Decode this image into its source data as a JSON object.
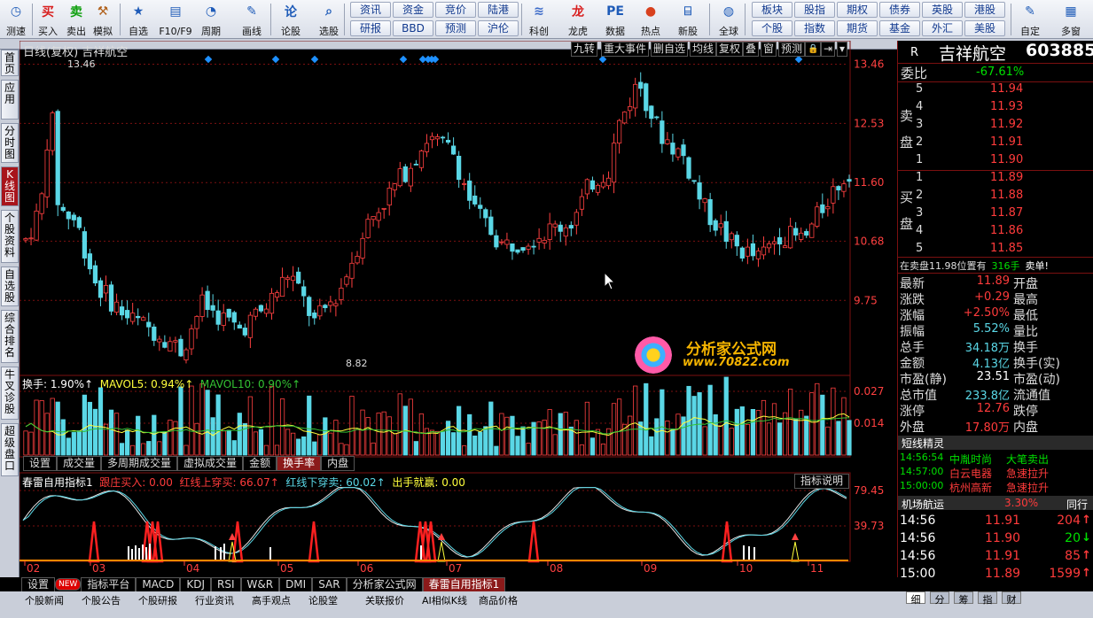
{
  "toolbar": {
    "items": [
      {
        "label": "测速",
        "icon": "clock-icon",
        "sym": "◷",
        "color": "#1e5bb8"
      },
      {
        "label": "买入",
        "icon": "buy-icon",
        "sym": "买",
        "color": "#d81e1e"
      },
      {
        "label": "卖出",
        "icon": "sell-icon",
        "sym": "卖",
        "color": "#10a010"
      },
      {
        "label": "模拟",
        "icon": "hammer-icon",
        "sym": "⚒",
        "color": "#b0601a"
      },
      {
        "label": "自选",
        "icon": "star-icon",
        "sym": "★",
        "color": "#1e5bb8"
      },
      {
        "label": "F10/F9",
        "icon": "f10-icon",
        "sym": "▤",
        "color": "#1e5bb8"
      },
      {
        "label": "周期",
        "icon": "period-icon",
        "sym": "◔",
        "color": "#1e5bb8"
      },
      {
        "label": "画线",
        "icon": "pen-icon",
        "sym": "✎",
        "color": "#1e5bb8"
      },
      {
        "label": "论股",
        "icon": "discuss-icon",
        "sym": "论",
        "color": "#1e5bb8"
      },
      {
        "label": "选股",
        "icon": "search-icon",
        "sym": "⌕",
        "color": "#1e5bb8"
      },
      {
        "label": "科创",
        "icon": "kechuang-icon",
        "sym": "≋",
        "color": "#3c6ac8"
      },
      {
        "label": "龙虎",
        "icon": "dragon-icon",
        "sym": "龙",
        "color": "#d81e1e"
      },
      {
        "label": "数据",
        "icon": "pe-icon",
        "sym": "PE",
        "color": "#1e5bb8"
      },
      {
        "label": "热点",
        "icon": "hot-icon",
        "sym": "●",
        "color": "#d8401e"
      },
      {
        "label": "新股",
        "icon": "ipo-icon",
        "sym": "⌸",
        "color": "#1e5bb8"
      },
      {
        "label": "全球",
        "icon": "globe-icon",
        "sym": "◍",
        "color": "#1e5bb8"
      },
      {
        "label": "自定",
        "icon": "custom-icon",
        "sym": "✎",
        "color": "#1e5bb8"
      },
      {
        "label": "多窗",
        "icon": "multiwindow-icon",
        "sym": "▦",
        "color": "#1e5bb8"
      }
    ],
    "small_buttons": {
      "col1": [
        "资讯",
        "研报"
      ],
      "col2": [
        "资金",
        "BBD"
      ],
      "col3": [
        "竞价",
        "预测"
      ],
      "col4": [
        "陆港",
        "沪伦"
      ],
      "col5": [
        "板块",
        "个股"
      ],
      "col6": [
        "股指",
        "指数"
      ],
      "col7": [
        "期权",
        "期货"
      ],
      "col8": [
        "债券",
        "基金"
      ],
      "col9": [
        "英股",
        "外汇"
      ],
      "col10": [
        "港股",
        "美股"
      ]
    }
  },
  "leftbar": {
    "tabs": [
      "首页",
      "应用",
      "分时图",
      "K线图",
      "个股资料",
      "自选股",
      "综合排名",
      "牛叉诊股",
      "超级盘口"
    ]
  },
  "chart_header": {
    "title": "日线(复权)  吉祥航空",
    "controls": [
      "九转",
      "重大事件",
      "删自选",
      "均线",
      "复权",
      "叠",
      "窗",
      "预测"
    ]
  },
  "price_axis": [
    "13.46",
    "12.53",
    "11.60",
    "10.68",
    "9.75"
  ],
  "high_label": "13.46",
  "low_label": "8.82",
  "volume_header": {
    "turnover": "换手: 1.90%↑",
    "mavol5": "MAVOL5: 0.94%↑",
    "mavol10": "MAVOL10: 0.90%↑"
  },
  "volume_axis": [
    "0.027",
    "0.014"
  ],
  "volume_tabs": [
    "设置",
    "成交量",
    "多周期成交量",
    "虚拟成交量",
    "金额",
    "换手率",
    "内盘"
  ],
  "indicator_header": {
    "name": "春雷自用指标1",
    "a": "跟庄买入: 0.00",
    "b": "红线上穿买: 66.07↑",
    "c": "红线下穿卖: 60.02↑",
    "d": "出手就赢: 0.00",
    "help": "指标说明"
  },
  "indicator_axis": [
    "79.45",
    "39.73"
  ],
  "date_axis": [
    "02",
    "03",
    "04",
    "05",
    "06",
    "07",
    "08",
    "09",
    "10",
    "11"
  ],
  "indicator_tabs": [
    "设置",
    "NEW",
    "指标平台",
    "MACD",
    "KDJ",
    "RSI",
    "W&R",
    "DMI",
    "SAR",
    "分析家公式网",
    "春雷自用指标1"
  ],
  "bottom_tabs": [
    "个股新闻",
    "个股公告",
    "个股研报",
    "行业资讯",
    "高手观点",
    "论股堂",
    "关联报价",
    "AI相似K线",
    "商品价格"
  ],
  "watermark": {
    "title": "分析家公式网",
    "url": "www.70822.com"
  },
  "right_panel": {
    "r_label": "R",
    "stock_name": "吉祥航空",
    "code": "603885",
    "weibi_label": "委比",
    "weibi": "-67.61%",
    "sell_label": "卖盘",
    "buy_label": "买盘",
    "sells": [
      {
        "lv": "5",
        "price": "11.94",
        "vol": ""
      },
      {
        "lv": "4",
        "price": "11.93",
        "vol": ""
      },
      {
        "lv": "3",
        "price": "11.92",
        "vol": ""
      },
      {
        "lv": "2",
        "price": "11.91",
        "vol": ""
      },
      {
        "lv": "1",
        "price": "11.90",
        "vol": ""
      }
    ],
    "buys": [
      {
        "lv": "1",
        "price": "11.89",
        "vol": ""
      },
      {
        "lv": "2",
        "price": "11.88",
        "vol": ""
      },
      {
        "lv": "3",
        "price": "11.87",
        "vol": ""
      },
      {
        "lv": "4",
        "price": "11.86",
        "vol": ""
      },
      {
        "lv": "5",
        "price": "11.85",
        "vol": ""
      }
    ],
    "notice": "在卖盘11.98位置有",
    "notice_qty": "316手",
    "notice_tail": "卖单!",
    "stats": [
      {
        "k": "最新",
        "v": "11.89",
        "c": "red",
        "k2": "开盘"
      },
      {
        "k": "涨跌",
        "v": "+0.29",
        "c": "red",
        "k2": "最高"
      },
      {
        "k": "涨幅",
        "v": "+2.50%",
        "c": "red",
        "k2": "最低"
      },
      {
        "k": "振幅",
        "v": "5.52%",
        "c": "cyan",
        "k2": "量比"
      },
      {
        "k": "总手",
        "v": "34.18万",
        "c": "cyan",
        "k2": "换手"
      },
      {
        "k": "金额",
        "v": "4.13亿",
        "c": "cyan",
        "k2": "换手(实)"
      },
      {
        "k": "市盈(静)",
        "v": "23.51",
        "c": "wht",
        "k2": "市盈(动)"
      },
      {
        "k": "总市值",
        "v": "233.8亿",
        "c": "cyan",
        "k2": "流通值"
      },
      {
        "k": "涨停",
        "v": "12.76",
        "c": "red",
        "k2": "跌停"
      },
      {
        "k": "外盘",
        "v": "17.80万",
        "c": "red",
        "k2": "内盘"
      }
    ],
    "short_title": "短线精灵",
    "short": [
      {
        "t": "14:56:54",
        "n": "中胤时尚",
        "e": "大笔卖出",
        "nc": "grn",
        "ec": "grn"
      },
      {
        "t": "14:57:00",
        "n": "白云电器",
        "e": "急速拉升",
        "nc": "red",
        "ec": "red"
      },
      {
        "t": "15:00:00",
        "n": "杭州高新",
        "e": "急速拉升",
        "nc": "red",
        "ec": "red"
      }
    ],
    "sector": {
      "name": "机场航运",
      "pct": "3.30%",
      "tail": "同行"
    },
    "ticks": [
      {
        "t": "14:56",
        "p": "11.91",
        "v": "204",
        "d": "up"
      },
      {
        "t": "14:56",
        "p": "11.90",
        "v": "20",
        "d": "down"
      },
      {
        "t": "14:56",
        "p": "11.91",
        "v": "85",
        "d": "up"
      },
      {
        "t": "15:00",
        "p": "11.89",
        "v": "1599",
        "d": "up"
      }
    ],
    "bottom_tabs": [
      "细",
      "分",
      "筹",
      "指",
      "财"
    ]
  },
  "chart_data": {
    "type": "candlestick",
    "y_range": [
      8.6,
      13.55
    ],
    "start": 9.9,
    "n": 155,
    "volume_range": [
      0,
      0.03
    ],
    "indicator_range": [
      0,
      95
    ]
  }
}
